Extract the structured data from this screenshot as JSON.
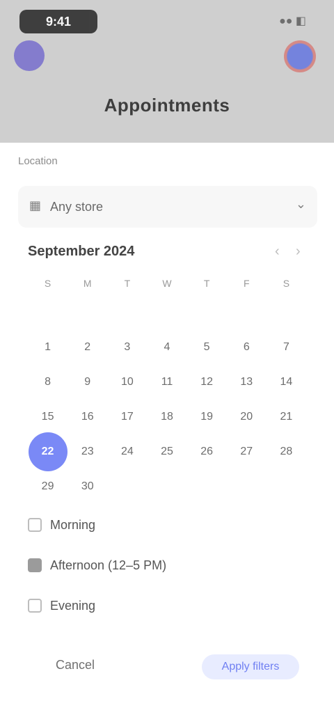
{
  "status": {
    "time": "9:41",
    "right": "●● ◧"
  },
  "header": {
    "title": "Appointments"
  },
  "sheet": {
    "section_label": "Location",
    "dropdown": {
      "icon": "calendar-icon",
      "value": "Any store",
      "chevron": "⌄"
    },
    "month": {
      "title": "September 2024",
      "prev": "‹",
      "next": "›"
    },
    "weekdays": [
      "S",
      "M",
      "T",
      "W",
      "T",
      "F",
      "S"
    ],
    "days": [
      [
        "",
        "",
        "",
        "",
        "",
        "",
        ""
      ],
      [
        "1",
        "2",
        "3",
        "4",
        "5",
        "6",
        "7"
      ],
      [
        "8",
        "9",
        "10",
        "11",
        "12",
        "13",
        "14"
      ],
      [
        "15",
        "16",
        "17",
        "18",
        "19",
        "20",
        "21"
      ],
      [
        "22",
        "23",
        "24",
        "25",
        "26",
        "27",
        "28"
      ],
      [
        "29",
        "30",
        "",
        "",
        "",
        "",
        ""
      ]
    ],
    "selected_day": "22",
    "options": [
      {
        "label": "Morning",
        "checked": false
      },
      {
        "label": "Afternoon (12–5 PM)",
        "checked": true
      },
      {
        "label": "Evening",
        "checked": false
      }
    ],
    "buttons": {
      "cancel": "Cancel",
      "primary": "Apply filters"
    }
  }
}
